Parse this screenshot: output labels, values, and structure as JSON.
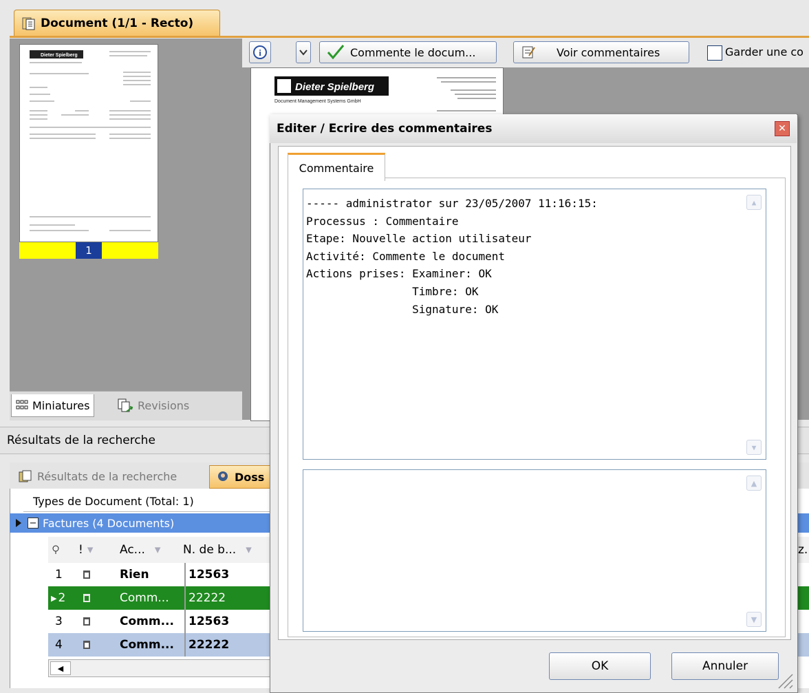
{
  "document_tab": {
    "title": "Document (1/1 - Recto)"
  },
  "thumbnail": {
    "page_number": "1",
    "company_name": "Dieter Spielberg"
  },
  "side_tabs": {
    "thumbnails": "Miniatures",
    "revisions": "Revisions"
  },
  "toolbar": {
    "comment_button": "Commente le docum...",
    "view_comments_button": "Voir commentaires",
    "keep_checkbox_label": "Garder une co"
  },
  "doc_preview": {
    "company_name": "Dieter Spielberg",
    "subtitle": "Document Management Systems GmbH"
  },
  "search_results": {
    "header": "Résultats de la recherche",
    "tab_results": "Résultats de la recherche",
    "tab_folder": "Doss",
    "group_header": "Types de Document (Total: 1)",
    "group_row": "Factures (4 Documents)",
    "columns": {
      "action": "Ac...",
      "number": "N. de b...",
      "extra": "z."
    },
    "rows": [
      {
        "index": "1",
        "action": "Rien",
        "number": "12563"
      },
      {
        "index": "2",
        "action": "Comm...",
        "number": "22222"
      },
      {
        "index": "3",
        "action": "Comm...",
        "number": "12563"
      },
      {
        "index": "4",
        "action": "Comm...",
        "number": "22222"
      }
    ]
  },
  "dialog": {
    "title": "Editer / Ecrire des commentaires",
    "tab_label": "Commentaire",
    "comment_lines": [
      "----- administrator sur 23/05/2007 11:16:15:",
      "Processus : Commentaire",
      "Etape: Nouvelle action utilisateur",
      "Activité: Commente le document",
      "Actions prises: Examiner: OK",
      "                Timbre: OK",
      "                Signature: OK"
    ],
    "ok_button": "OK",
    "cancel_button": "Annuler"
  },
  "colors": {
    "selected_row": "#1f8a1f",
    "group_row": "#5b8fe0",
    "highlight_row": "#b6c8e4",
    "tab_accent": "#f0a030"
  }
}
